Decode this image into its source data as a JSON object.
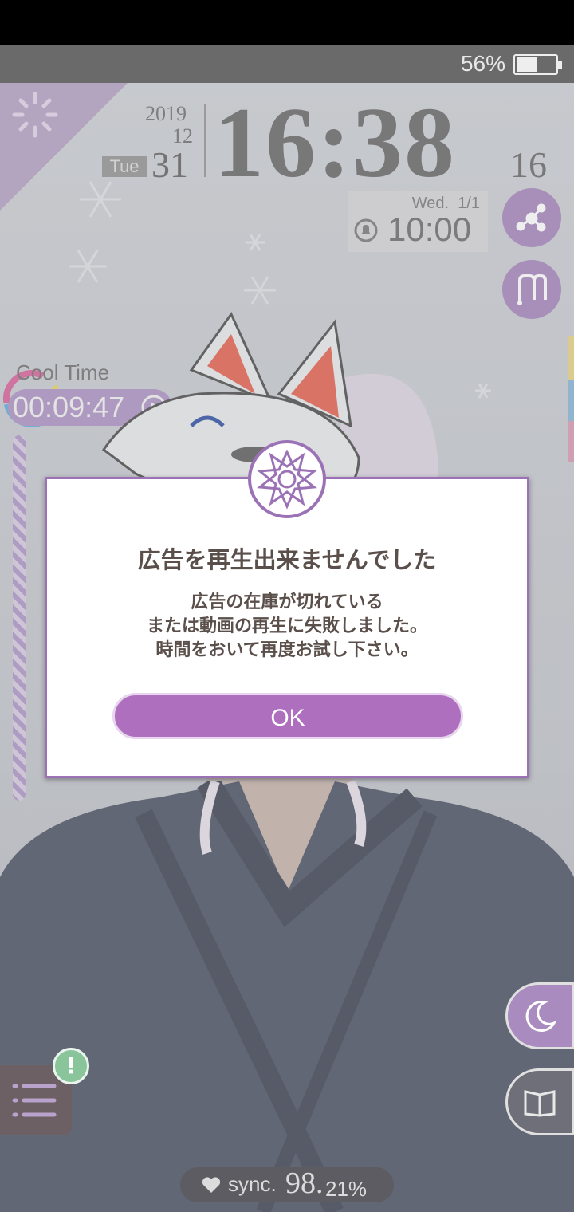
{
  "status_bar": {
    "battery_percent": "56%",
    "battery_level": 0.56
  },
  "clock": {
    "year": "2019",
    "month": "12",
    "weekday": "Tue",
    "day": "31",
    "time": "16:38",
    "seconds": "16"
  },
  "alarm": {
    "day": "Wed.",
    "date": "1/1",
    "time": "10:00"
  },
  "cool_time": {
    "label": "Cool Time",
    "value": "00:09:47"
  },
  "dialog": {
    "title": "広告を再生出来ませんでした",
    "message_lines": [
      "広告の在庫が切れている",
      "または動画の再生に失敗しました。",
      "時間をおいて再度お試し下さい。"
    ],
    "ok_label": "OK"
  },
  "sync": {
    "label": "sync.",
    "value_int": "98.",
    "value_decimal": "21%"
  },
  "colors": {
    "accent_purple": "#ad6fbe",
    "dialog_border": "#9b72b5",
    "alert_green": "#8ac49a"
  },
  "icons": [
    "share-icon",
    "m-logo-icon",
    "play-icon",
    "bell-icon",
    "menu-list-icon",
    "alert-icon",
    "moon-icon",
    "book-icon",
    "heart-icon",
    "emblem-icon"
  ]
}
